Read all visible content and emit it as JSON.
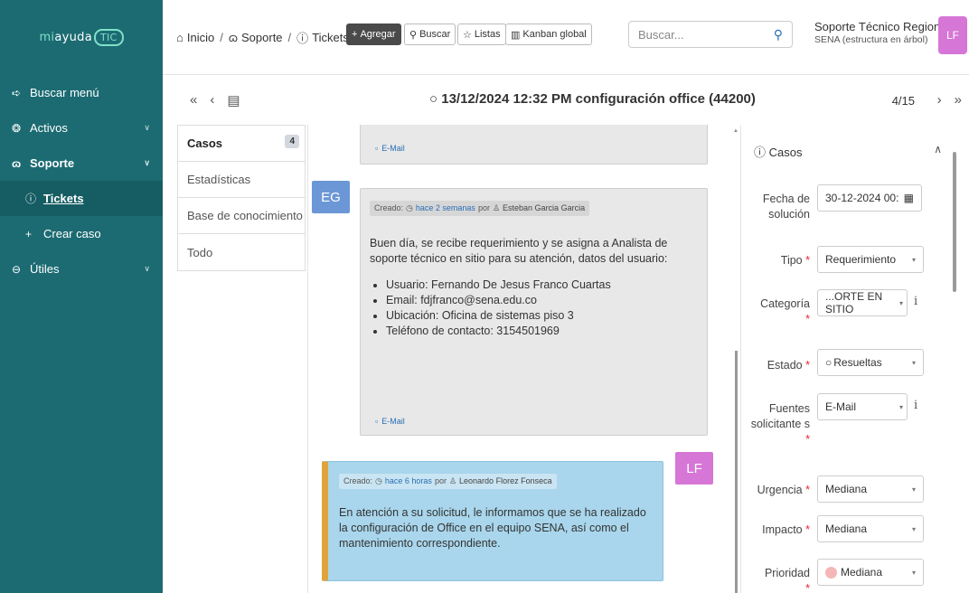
{
  "sidebar": {
    "logo": {
      "prefix": "mi",
      "mid": "ayuda",
      "tic": "TIC"
    },
    "items": [
      {
        "label": "Buscar menú",
        "icon": "arrow-right-icon"
      },
      {
        "label": "Activos",
        "icon": "box-icon"
      },
      {
        "label": "Soporte",
        "icon": "headset-icon"
      },
      {
        "label": "Tickets",
        "icon": "ticket-icon"
      },
      {
        "label": "Crear caso",
        "icon": "plus-icon"
      },
      {
        "label": "Útiles",
        "icon": "briefcase-icon"
      }
    ]
  },
  "topbar": {
    "breadcrumb": [
      "Inicio",
      "Soporte",
      "Tickets"
    ],
    "buttons": {
      "add": "Agregar",
      "search": "Buscar",
      "lists": "Listas",
      "kanban": "Kanban global"
    },
    "search_placeholder": "Buscar...",
    "entity_name": "Soporte Técnico Regionales",
    "entity_sub": "SENA (estructura en árbol)",
    "user_initials": "LF"
  },
  "ticket": {
    "title": "13/12/2024 12:32 PM configuración office (44200)",
    "position": "4/15"
  },
  "tabs": [
    {
      "label": "Casos",
      "badge": "4"
    },
    {
      "label": "Estadísticas"
    },
    {
      "label": "Base de conocimiento"
    },
    {
      "label": "Todo"
    }
  ],
  "timeline": {
    "email_label": "E-Mail",
    "entry1": {
      "initials": "EG",
      "created": "Creado:",
      "when": "hace 2 semanas",
      "by": "por",
      "author": "Esteban Garcia Garcia",
      "body": "Buen día, se recibe requerimiento y se asigna a Analista de soporte técnico en sitio para su atención, datos del usuario:",
      "list": [
        "Usuario: Fernando De Jesus Franco Cuartas",
        "Email: fdjfranco@sena.edu.co",
        "Ubicación: Oficina de sistemas piso 3",
        "Teléfono de contacto: 3154501969"
      ]
    },
    "entry2": {
      "initials": "LF",
      "created": "Creado:",
      "when": "hace 6 horas",
      "by": "por",
      "author": "Leonardo Florez Fonseca",
      "body": "En atención a su solicitud, le informamos que se ha realizado la configuración de Office en el equipo SENA, así como el mantenimiento correspondiente."
    }
  },
  "panel": {
    "title": "Casos",
    "fields": {
      "fecha_label": "Fecha de solución",
      "fecha_value": "30-12-2024 00:",
      "tipo_label": "Tipo",
      "tipo_value": "Requerimiento",
      "categoria_label": "Categoría",
      "categoria_value": "...ORTE EN SITIO",
      "estado_label": "Estado",
      "estado_value": "Resueltas",
      "fuentes_label": "Fuentes solicitante s",
      "fuentes_value": "E-Mail",
      "urgencia_label": "Urgencia",
      "urgencia_value": "Mediana",
      "impacto_label": "Impacto",
      "impacto_value": "Mediana",
      "prioridad_label": "Prioridad",
      "prioridad_value": "Mediana"
    }
  },
  "colors": {
    "sidebar_bg": "#1c6b72",
    "avatar_eg": "#6b97d6",
    "avatar_lf": "#d676d6",
    "followup_bg": "#a9d6ec",
    "followup_bar": "#e0a33a",
    "priority_dot": "#f4b6b6"
  }
}
